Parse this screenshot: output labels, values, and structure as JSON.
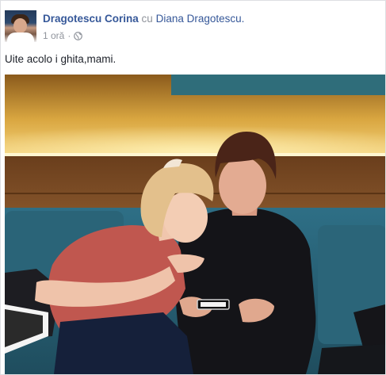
{
  "post": {
    "author": "Dragotescu Corina",
    "with_word": "cu",
    "tagged": "Diana Dragotescu.",
    "time": "1 oră",
    "separator": "·",
    "privacy_icon": "globe-icon",
    "text": "Uite acolo i ghita,mami.",
    "photo_icon": "photo-two-women-with-phone"
  },
  "colors": {
    "link": "#365899",
    "meta": "#90949c",
    "text": "#1d2129"
  }
}
